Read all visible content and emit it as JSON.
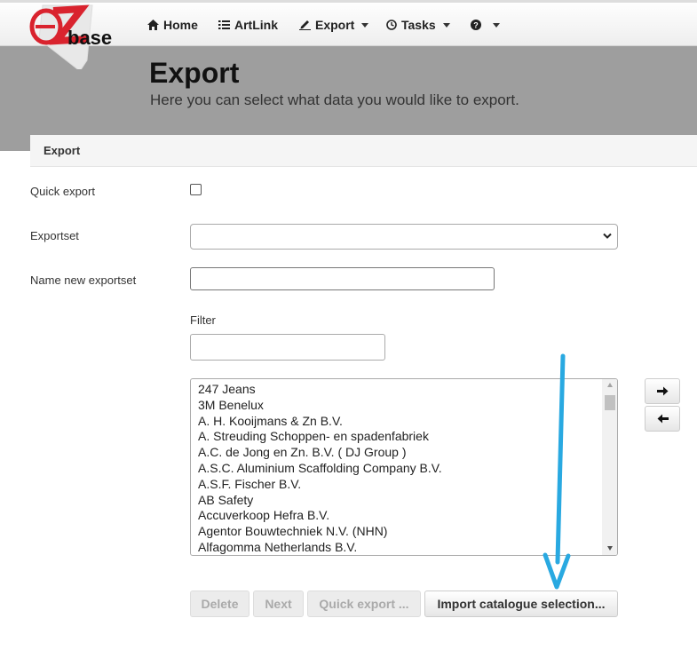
{
  "logo": {
    "letter": "Z",
    "text": "base",
    "brand_red": "#d9232e"
  },
  "nav": {
    "items": [
      {
        "label": "Home",
        "icon": "home-icon"
      },
      {
        "label": "ArtLink",
        "icon": "list-icon"
      },
      {
        "label": "Export",
        "icon": "export-icon",
        "dropdown": true
      },
      {
        "label": "Tasks",
        "icon": "clock-icon",
        "dropdown": true
      },
      {
        "label": "",
        "icon": "help-icon",
        "dropdown": true
      }
    ]
  },
  "hero": {
    "title": "Export",
    "subtitle": "Here you can select what data you would like to export."
  },
  "panel": {
    "title": "Export"
  },
  "form": {
    "quick_export_label": "Quick export",
    "quick_export_checked": false,
    "exportset_label": "Exportset",
    "exportset_value": "",
    "name_new_label": "Name new exportset",
    "name_new_value": "",
    "filter_label": "Filter",
    "filter_value": ""
  },
  "list": {
    "items": [
      "247 Jeans",
      "3M Benelux",
      "A. H. Kooijmans & Zn B.V.",
      "A. Streuding Schoppen- en spadenfabriek",
      "A.C. de Jong en Zn. B.V. ( DJ Group )",
      "A.S.C. Aluminium Scaffolding Company B.V.",
      "A.S.F. Fischer B.V.",
      "AB Safety",
      "Accuverkoop Hefra B.V.",
      "Agentor Bouwtechniek N.V. (NHN)",
      "Alfagomma Netherlands B.V."
    ]
  },
  "move_buttons": {
    "right_icon": "arrow-right-icon",
    "left_icon": "arrow-left-icon"
  },
  "buttons": {
    "delete": "Delete",
    "next": "Next",
    "quick_export": "Quick export ...",
    "import_catalogue": "Import catalogue selection..."
  },
  "colors": {
    "hero_bg": "#9e9e9e",
    "annotation_arrow": "#29a9e1"
  }
}
